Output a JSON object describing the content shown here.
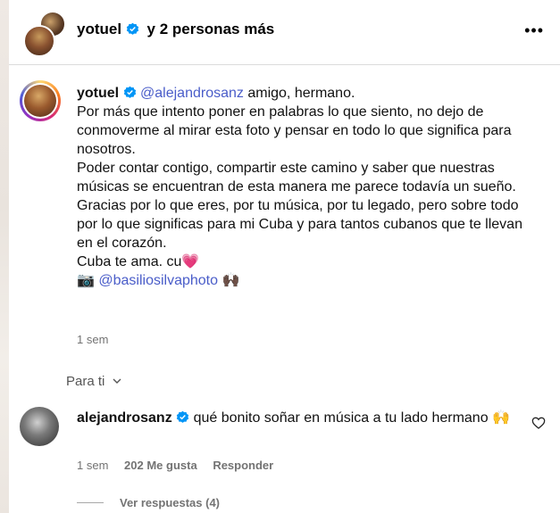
{
  "header": {
    "username": "yotuel",
    "others": "y 2 personas más",
    "more_icon": "more-horizontal-icon"
  },
  "post": {
    "username": "yotuel",
    "mention": "@alejandrosanz",
    "first_line": " amigo, hermano.",
    "paragraph1": "Por más que intento poner en palabras lo que siento, no dejo de conmoverme al mirar esta foto y pensar en todo lo que significa para nosotros.",
    "paragraph2": "Poder contar contigo, compartir este camino y saber que nuestras músicas se encuentran de esta manera me parece todavía un sueño.",
    "paragraph3": "Gracias por lo que eres, por tu música, por tu legado, pero sobre todo por lo que significas para mi Cuba y para tantos cubanos que te llevan en el corazón.",
    "closing": "Cuba te ama. cu",
    "heart_emoji": "💗",
    "camera_emoji": "📷",
    "photo_mention": "@basiliosilvaphoto",
    "hands_emoji": "🙌🏿",
    "time": "1 sem"
  },
  "filter": {
    "label": "Para ti"
  },
  "comment": {
    "username": "alejandrosanz",
    "text": "qué bonito soñar en música a tu lado hermano",
    "emoji": "🙌",
    "time": "1 sem",
    "likes": "202 Me gusta",
    "reply": "Responder",
    "view_replies": "Ver respuestas (4)"
  },
  "colors": {
    "verified": "#0095f6",
    "mention": "#4a5dc9",
    "muted": "#737373"
  }
}
